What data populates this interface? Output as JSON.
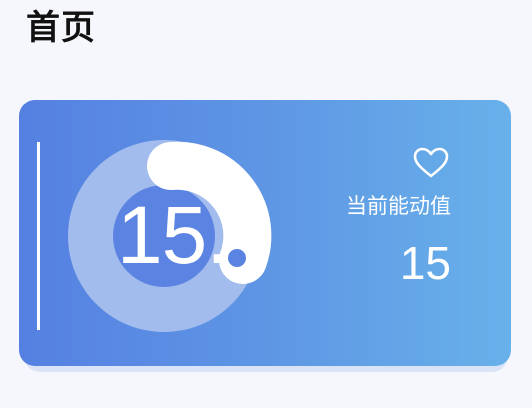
{
  "header": {
    "title": "首页"
  },
  "energy_card": {
    "gauge_value": "15.",
    "label": "当前能动值",
    "value": "15",
    "icon": "heart-icon",
    "colors": {
      "gradient_start": "#5580e2",
      "gradient_end": "#68b1ea",
      "ring": "#a3bcee",
      "ring_inner": "#5b83e2",
      "arc": "#ffffff"
    }
  }
}
